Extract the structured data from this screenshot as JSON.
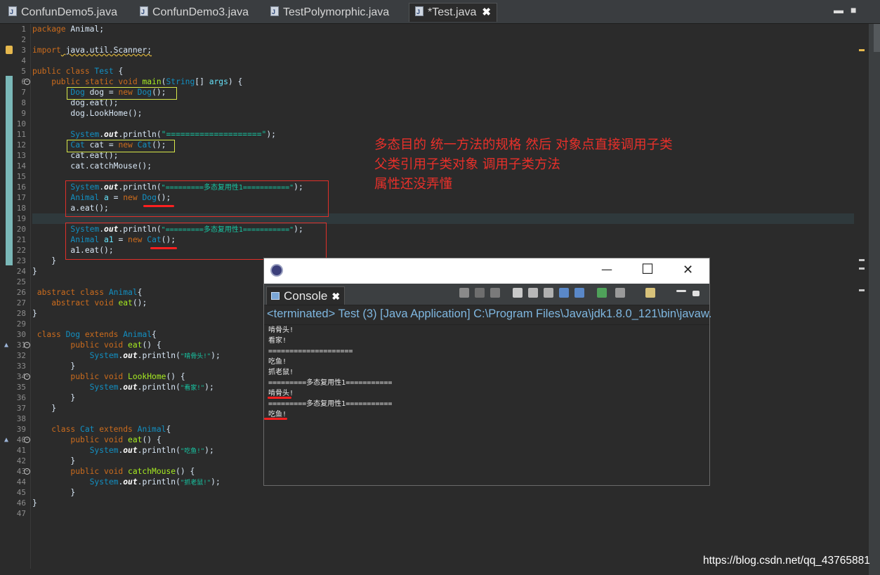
{
  "tabs": [
    {
      "label": "ConfunDemo5.java"
    },
    {
      "label": "ConfunDemo3.java"
    },
    {
      "label": "TestPolymorphic.java"
    },
    {
      "label": "*Test.java"
    }
  ],
  "window_controls": {
    "minimize": "▬",
    "restore": "■"
  },
  "line_numbers": [
    "1",
    "2",
    "3",
    "4",
    "5",
    "6",
    "7",
    "8",
    "9",
    "10",
    "11",
    "12",
    "13",
    "14",
    "15",
    "16",
    "17",
    "18",
    "19",
    "20",
    "21",
    "22",
    "23",
    "24",
    "25",
    "26",
    "27",
    "28",
    "29",
    "30",
    "31",
    "32",
    "33",
    "34",
    "35",
    "36",
    "37",
    "38",
    "39",
    "40",
    "41",
    "42",
    "43",
    "44",
    "45",
    "46",
    "47"
  ],
  "code": {
    "l1_a": "package",
    "l1_b": " Animal;",
    "l3_a": "import",
    "l3_b": " java.util.Scanner;",
    "l5_a": "public class ",
    "l5_b": "Test",
    "l5_c": " {",
    "l6_a": "    public static void ",
    "l6_b": "main",
    "l6_c": "(",
    "l6_d": "String",
    "l6_e": "[] ",
    "l6_f": "args",
    "l6_g": ") {",
    "l7_a": "        ",
    "l7_b": "Dog",
    "l7_c": " dog = ",
    "l7_d": "new",
    "l7_e": " ",
    "l7_f": "Dog",
    "l7_g": "();",
    "l8": "        dog.eat();",
    "l9": "        dog.LookHome();",
    "l11_a": "        ",
    "l11_b": "System",
    "l11_c": ".",
    "l11_d": "out",
    "l11_e": ".println(",
    "l11_f": "\"====================\"",
    "l11_g": ");",
    "l12_a": "        ",
    "l12_b": "Cat",
    "l12_c": " cat = ",
    "l12_d": "new",
    "l12_e": " ",
    "l12_f": "Cat",
    "l12_g": "();",
    "l13": "        cat.eat();",
    "l14": "        cat.catchMouse();",
    "l16_a": "        ",
    "l16_b": "System",
    "l16_c": ".",
    "l16_d": "out",
    "l16_e": ".println(",
    "l16_f": "\"=========多态复用性1===========\"",
    "l16_g": ");",
    "l17_a": "        ",
    "l17_b": "Animal",
    "l17_c": " a",
    "l17_d": " = ",
    "l17_e": "new",
    "l17_f": " ",
    "l17_g": "Dog",
    "l17_h": "();",
    "l18": "        a.eat();",
    "l20_a": "        ",
    "l20_b": "System",
    "l20_c": ".",
    "l20_d": "out",
    "l20_e": ".println(",
    "l20_f": "\"=========多态复用性1===========\"",
    "l20_g": ");",
    "l21_a": "        ",
    "l21_b": "Animal",
    "l21_c": " a1",
    "l21_d": " = ",
    "l21_e": "new",
    "l21_f": " ",
    "l21_g": "Cat",
    "l21_h": "();",
    "l22": "        a1.eat();",
    "l23": "    }",
    "l24": "}",
    "l26_a": " abstract class ",
    "l26_b": "Animal",
    "l26_c": "{",
    "l27_a": "    abstract void ",
    "l27_b": "eat",
    "l27_c": "();",
    "l28": "}",
    "l30_a": " class ",
    "l30_b": "Dog",
    "l30_c": " extends ",
    "l30_d": "Animal",
    "l30_e": "{",
    "l31_a": "        public void ",
    "l31_b": "eat",
    "l31_c": "() {",
    "l32_a": "            ",
    "l32_b": "System",
    "l32_c": ".",
    "l32_d": "out",
    "l32_e": ".println(",
    "l32_f": "\"啃骨头!\"",
    "l32_g": ");",
    "l33": "        }",
    "l34_a": "        public void ",
    "l34_b": "LookHome",
    "l34_c": "() {",
    "l35_a": "            ",
    "l35_b": "System",
    "l35_c": ".",
    "l35_d": "out",
    "l35_e": ".println(",
    "l35_f": "\"看家!\"",
    "l35_g": ");",
    "l36": "        }",
    "l37": "    }",
    "l39_a": "    class ",
    "l39_b": "Cat",
    "l39_c": " extends ",
    "l39_d": "Animal",
    "l39_e": "{",
    "l40_a": "        public void ",
    "l40_b": "eat",
    "l40_c": "() {",
    "l41_a": "            ",
    "l41_b": "System",
    "l41_c": ".",
    "l41_d": "out",
    "l41_e": ".println(",
    "l41_f": "\"吃鱼!\"",
    "l41_g": ");",
    "l42": "        }",
    "l43_a": "        public void ",
    "l43_b": "catchMouse",
    "l43_c": "() {",
    "l44_a": "            ",
    "l44_b": "System",
    "l44_c": ".",
    "l44_d": "out",
    "l44_e": ".println(",
    "l44_f": "\"抓老鼠!\"",
    "l44_g": ");",
    "l45": "        }",
    "l46": "}"
  },
  "annotation": {
    "line1": "多态目的 统一方法的规格 然后 对象点直接调用子类",
    "line2": "父类引用子类对象 调用子类方法",
    "line3": "属性还没弄懂"
  },
  "console": {
    "minimize": "—",
    "maximize": "☐",
    "close": "✕",
    "tab_label": "Console",
    "tab_close": "✖",
    "status": "<terminated> Test (3) [Java Application] C:\\Program Files\\Java\\jdk1.8.0_121\\bin\\javaw.",
    "output": [
      "啃骨头!",
      "看家!",
      "====================",
      "吃鱼!",
      "抓老鼠!",
      "=========多态复用性1===========",
      "啃骨头!",
      "=========多态复用性1===========",
      "吃鱼!"
    ]
  },
  "watermark": "https://blog.csdn.net/qq_43765881",
  "colors": {
    "keyword": "#cc6c1d",
    "type": "#1290c3",
    "method": "#a7ec21",
    "string": "#17c6a3",
    "annotation": "#e8302a",
    "underline": "#ff2020"
  }
}
